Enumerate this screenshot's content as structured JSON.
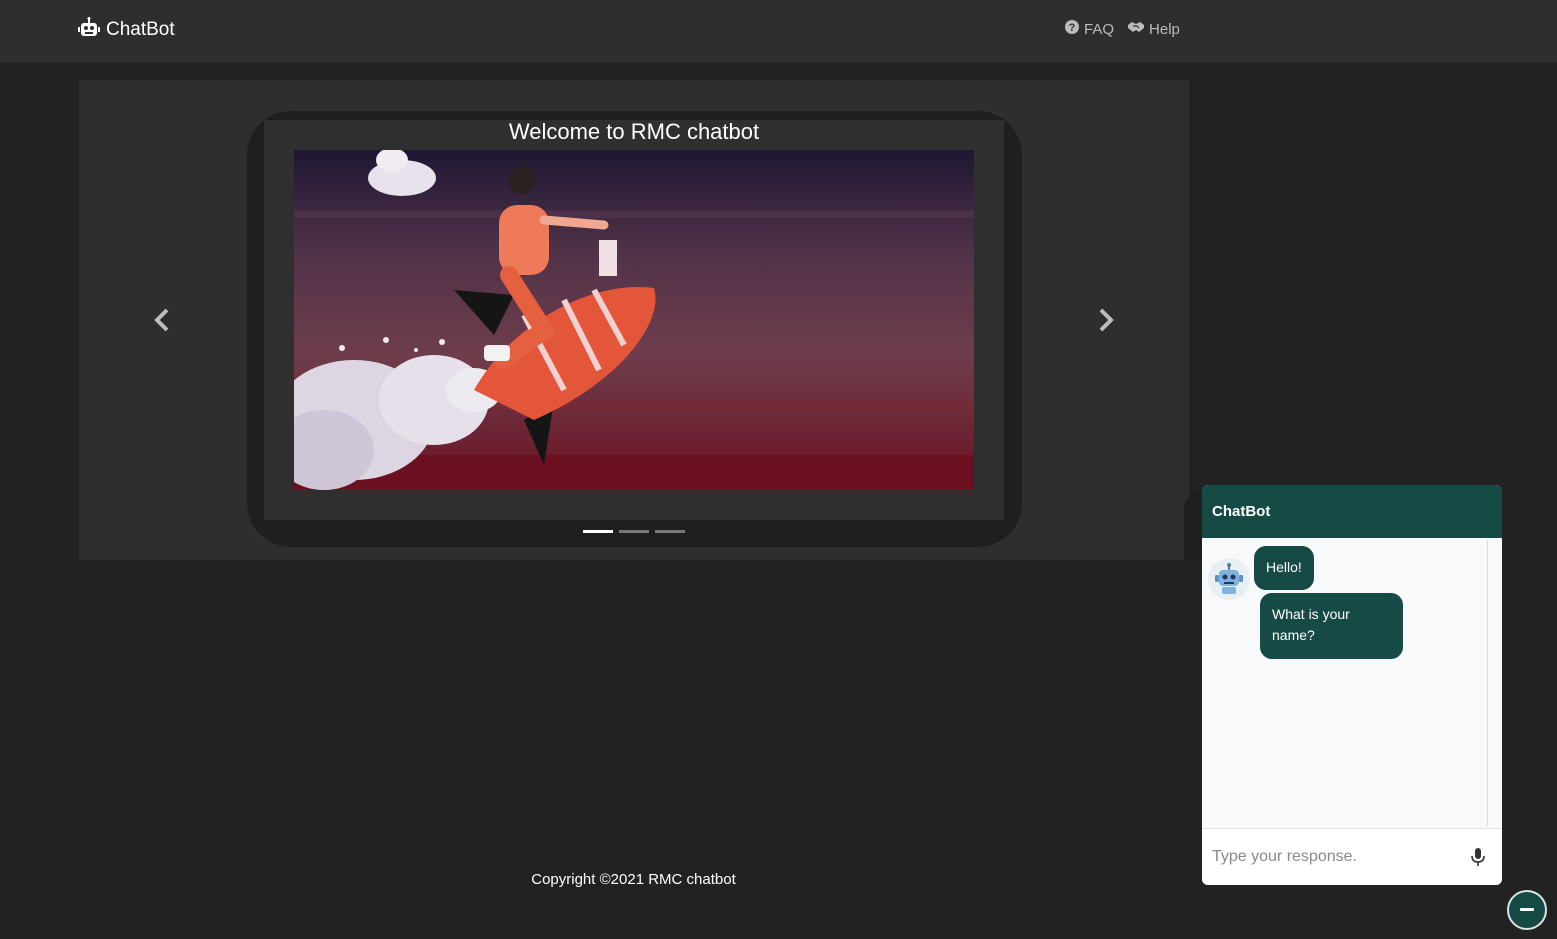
{
  "navbar": {
    "brand": "ChatBot",
    "links": [
      {
        "label": "FAQ",
        "icon": "question-circle-icon"
      },
      {
        "label": "Help",
        "icon": "handshake-icon"
      }
    ]
  },
  "carousel": {
    "title": "Welcome to RMC chatbot",
    "indicators": 3,
    "active_index": 0
  },
  "footer": {
    "copyright": "Copyright ©2021 RMC chatbot"
  },
  "chat": {
    "title": "ChatBot",
    "messages": [
      {
        "from": "bot",
        "text": "Hello!"
      },
      {
        "from": "bot",
        "text": "What is your name?"
      }
    ],
    "input_placeholder": "Type your response.",
    "input_value": ""
  },
  "colors": {
    "page_bg": "#222222",
    "navbar_bg": "#2e2e2e",
    "chat_accent": "#164a45"
  }
}
